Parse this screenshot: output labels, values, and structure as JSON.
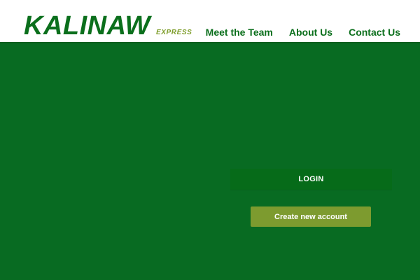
{
  "brand": {
    "name": "KALINAW",
    "sub": "EXPRESS"
  },
  "nav": {
    "items": [
      {
        "label": "Meet the Team"
      },
      {
        "label": "About Us"
      },
      {
        "label": "Contact Us"
      }
    ]
  },
  "main": {
    "login_label": "LOGIN",
    "create_label": "Create new account"
  },
  "colors": {
    "header_bg": "#ffffff",
    "page_bg": "#086b22",
    "brand_green": "#0b6f1c",
    "accent_olive": "#7d9b2f",
    "login_bg": "#066b19"
  }
}
